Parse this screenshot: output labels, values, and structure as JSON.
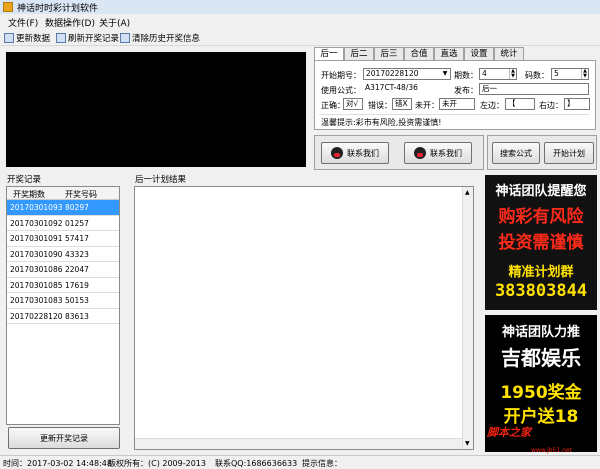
{
  "window": {
    "title": "神话时时彩计划软件"
  },
  "menu": [
    "文件(F)",
    "数据操作(D)",
    "关于(A)"
  ],
  "toolbar": [
    "更新数据",
    "刷新开奖记录",
    "清除历史开奖信息"
  ],
  "tabs": [
    "后一",
    "后二",
    "后三",
    "合值",
    "直选",
    "设置",
    "统计"
  ],
  "settings": {
    "start_label": "开始期号：",
    "start_value": "20170228120",
    "period_label": "期数：",
    "period_value": "4",
    "code_label": "码数：",
    "code_value": "5",
    "formula_label": "使用公式：",
    "formula_value": "A317CT-48/36",
    "publish_label": "发布：",
    "publish_value": "后一",
    "correct_label": "正确：",
    "correct_value": "对√",
    "wrong_label": "错误：",
    "wrong_value": "错X",
    "open_label": "未开：",
    "open_value": "未开",
    "left_label": "左边：",
    "left_value": "【",
    "right_label": "右边：",
    "right_value": "】",
    "tip": "温馨提示:彩市有风险,投资需谨慎!"
  },
  "buttons": {
    "contact1": "联系我们",
    "contact2": "联系我们",
    "search": "搜索公式",
    "start": "开始计划",
    "update_records": "更新开奖记录"
  },
  "records": {
    "title": "开奖记录",
    "columns": [
      "开奖期数",
      "开奖号码"
    ],
    "rows": [
      [
        "20170301093",
        "80297"
      ],
      [
        "20170301092",
        "01257"
      ],
      [
        "20170301091",
        "57417"
      ],
      [
        "20170301090",
        "43323"
      ],
      [
        "20170301086",
        "22047"
      ],
      [
        "20170301085",
        "17619"
      ],
      [
        "20170301083",
        "50153"
      ],
      [
        "20170228120",
        "83613"
      ]
    ],
    "selected_index": 0
  },
  "result_title": "后一计划结果",
  "ad1": {
    "line1": "神话团队提醒您",
    "line2": "购彩有风险",
    "line3": "投资需谨慎",
    "line4": "精准计划群",
    "line5": "383803844"
  },
  "ad2": {
    "line1": "神话团队力推",
    "line2": "吉都娱乐",
    "line3": "1950奖金",
    "line4": "开户送18"
  },
  "watermark": {
    "text": "脚本之家",
    "url": "www.jb51.net"
  },
  "status": [
    "时间：2017-03-02 14:48:48",
    "版权所有：(C) 2009-2013",
    "联系QQ:1686636633",
    "提示信息："
  ],
  "colors": {
    "selection": "#3399ff",
    "ad_red": "#e21",
    "ad_yellow": "#ffe200"
  }
}
